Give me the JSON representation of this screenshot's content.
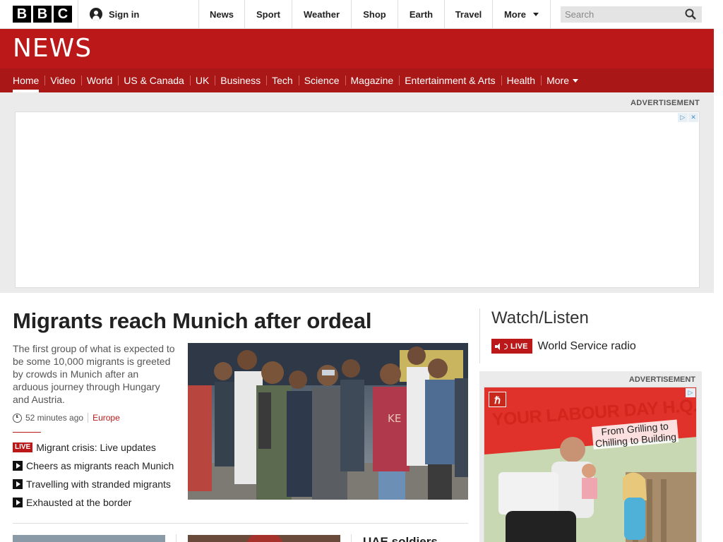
{
  "masthead": {
    "logo_letters": [
      "B",
      "B",
      "C"
    ],
    "signin_label": "Sign in",
    "nav": [
      "News",
      "Sport",
      "Weather",
      "Shop",
      "Earth",
      "Travel",
      "More"
    ],
    "search_placeholder": "Search"
  },
  "banner": {
    "wordmark": "NEWS"
  },
  "section_nav": {
    "items": [
      "Home",
      "Video",
      "World",
      "US & Canada",
      "UK",
      "Business",
      "Tech",
      "Science",
      "Magazine",
      "Entertainment & Arts",
      "Health",
      "More"
    ],
    "active": "Home"
  },
  "top_ad": {
    "label": "ADVERTISEMENT"
  },
  "lead": {
    "headline": "Migrants reach Munich after ordeal",
    "summary": "The first group of what is expected to be some 10,000 migrants is greeted by crowds in Munich after an arduous journey through Hungary and Austria.",
    "time": "52 minutes ago",
    "category": "Europe",
    "related": [
      {
        "badge": "LIVE",
        "text": "Migrant crisis: Live updates"
      },
      {
        "badge": "video",
        "text": "Cheers as migrants reach Munich"
      },
      {
        "badge": "video",
        "text": "Travelling with stranded migrants"
      },
      {
        "badge": "video",
        "text": "Exhausted at the border"
      }
    ],
    "photo_shirt_text": "KE"
  },
  "next_story": {
    "headline": "UAE soldiers"
  },
  "watch_listen": {
    "title": "Watch/Listen",
    "live_tag": "LIVE",
    "radio_label": "World Service radio"
  },
  "side_ad": {
    "label": "ADVERTISEMENT",
    "logo": "ℏ",
    "headline": "YOUR LABOUR DAY H.Q.",
    "sub_line1": "From Grilling to",
    "sub_line2": "Chilling to Building"
  },
  "colors": {
    "brand_red": "#bb1919",
    "nav_red": "#a91717",
    "ad_red": "#d2251c"
  }
}
